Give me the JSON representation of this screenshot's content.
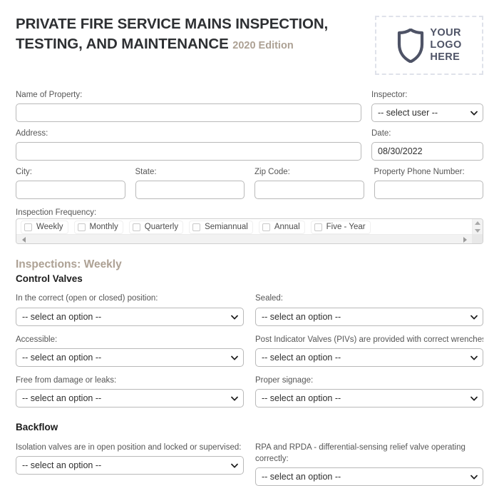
{
  "header": {
    "title": "PRIVATE FIRE SERVICE MAINS INSPECTION, TESTING, AND MAINTENANCE",
    "edition": "2020 Edition",
    "logo": {
      "icon": "shield-icon",
      "line1": "YOUR",
      "line2": "LOGO",
      "line3": "HERE"
    }
  },
  "colors": {
    "title": "#2e3033",
    "accent_taupe": "#ada194",
    "logo_navy": "#4e5366",
    "label_grey": "#565656",
    "border": "#b9b9b9",
    "dashed_border": "#dfe2ea"
  },
  "property": {
    "name_label": "Name of Property:",
    "name_value": "",
    "address_label": "Address:",
    "address_value": "",
    "city_label": "City:",
    "city_value": "",
    "state_label": "State:",
    "state_value": "",
    "zip_label": "Zip Code:",
    "zip_value": "",
    "phone_label": "Property Phone Number:",
    "phone_value": ""
  },
  "inspector": {
    "label": "Inspector:",
    "selected": "-- select user --",
    "date_label": "Date:",
    "date_value": "08/30/2022"
  },
  "frequency": {
    "label": "Inspection Frequency:",
    "options": [
      {
        "label": "Weekly",
        "checked": false
      },
      {
        "label": "Monthly",
        "checked": false
      },
      {
        "label": "Quarterly",
        "checked": false
      },
      {
        "label": "Semiannual",
        "checked": false
      },
      {
        "label": "Annual",
        "checked": false
      },
      {
        "label": "Five - Year",
        "checked": false
      }
    ]
  },
  "select_placeholder": "-- select an option --",
  "inspections": {
    "section_title": "Inspections: Weekly",
    "groups": [
      {
        "name": "Control Valves",
        "questions": [
          {
            "label": "In the correct (open or closed) position:",
            "value": "-- select an option --"
          },
          {
            "label": "Sealed:",
            "value": "-- select an option --"
          },
          {
            "label": "Accessible:",
            "value": "-- select an option --"
          },
          {
            "label": "Post Indicator Valves (PIVs) are provided with correct wrenches:",
            "value": "-- select an option --"
          },
          {
            "label": "Free from damage or leaks:",
            "value": "-- select an option --"
          },
          {
            "label": "Proper signage:",
            "value": "-- select an option --"
          }
        ]
      },
      {
        "name": "Backflow",
        "questions": [
          {
            "label": "Isolation valves are in open position and locked or supervised:",
            "value": "-- select an option --"
          },
          {
            "label": "RPA and RPDA - differential-sensing relief valve operating correctly:",
            "value": "-- select an option --"
          }
        ]
      }
    ]
  }
}
